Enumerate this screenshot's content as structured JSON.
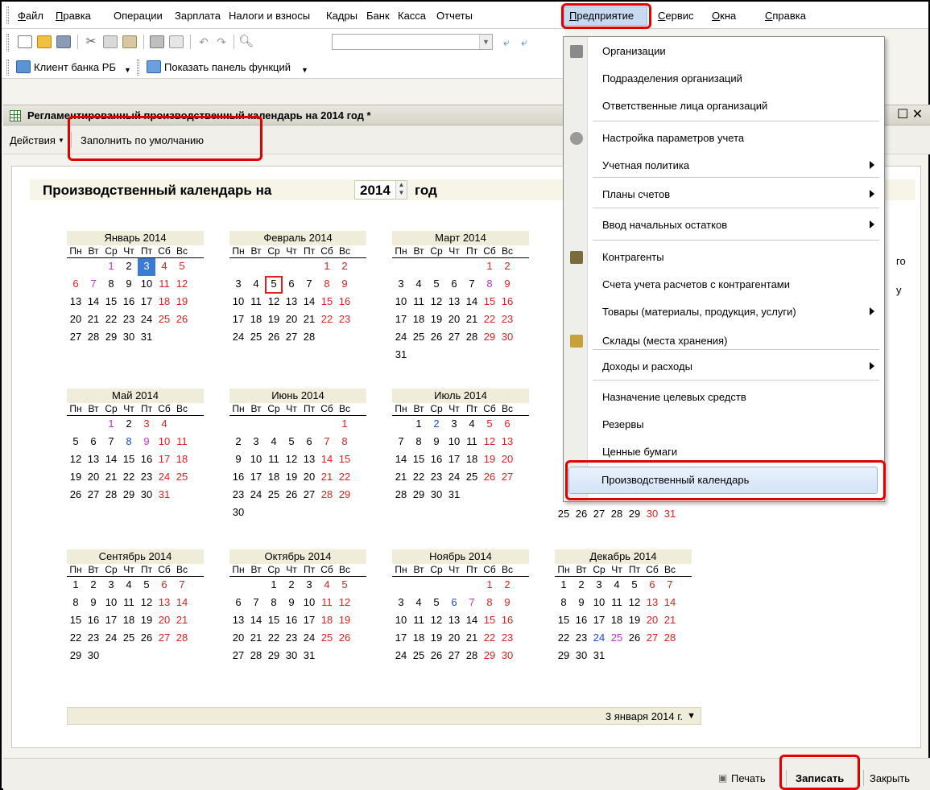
{
  "menubar": {
    "items": [
      "Файл",
      "Правка",
      "Операции",
      "Зарплата",
      "Налоги и взносы",
      "Кадры",
      "Банк",
      "Касса",
      "Отчеты",
      "Предприятие",
      "Сервис",
      "Окна",
      "Справка"
    ]
  },
  "toolbar2": {
    "bank_client": "Клиент банка РБ",
    "show_panel": "Показать панель функций"
  },
  "document": {
    "title": "Регламентированный производственный календарь на 2014 год *",
    "actions_label": "Действия",
    "fill_default": "Заполнить по умолчанию",
    "calendar_label": "Производственный календарь на",
    "year": "2014",
    "year_suffix": "год",
    "selected_date": "3 января 2014 г.",
    "partial_text": [
      "го",
      "у"
    ]
  },
  "weekday_headers": [
    "Пн",
    "Вт",
    "Ср",
    "Чт",
    "Пт",
    "Сб",
    "Вс"
  ],
  "months": [
    {
      "name": "Январь 2014",
      "weeks": [
        [
          null,
          null,
          "1",
          "2",
          "3",
          "4",
          "5"
        ],
        [
          "6",
          "7",
          "8",
          "9",
          "10",
          "11",
          "12"
        ],
        [
          "13",
          "14",
          "15",
          "16",
          "17",
          "18",
          "19"
        ],
        [
          "20",
          "21",
          "22",
          "23",
          "24",
          "25",
          "26"
        ],
        [
          "27",
          "28",
          "29",
          "30",
          "31",
          null,
          null
        ]
      ]
    },
    {
      "name": "Февраль 2014",
      "weeks": [
        [
          null,
          null,
          null,
          null,
          null,
          "1",
          "2"
        ],
        [
          "3",
          "4",
          "5",
          "6",
          "7",
          "8",
          "9"
        ],
        [
          "10",
          "11",
          "12",
          "13",
          "14",
          "15",
          "16"
        ],
        [
          "17",
          "18",
          "19",
          "20",
          "21",
          "22",
          "23"
        ],
        [
          "24",
          "25",
          "26",
          "27",
          "28",
          null,
          null
        ]
      ]
    },
    {
      "name": "Март 2014",
      "weeks": [
        [
          null,
          null,
          null,
          null,
          null,
          "1",
          "2"
        ],
        [
          "3",
          "4",
          "5",
          "6",
          "7",
          "8",
          "9"
        ],
        [
          "10",
          "11",
          "12",
          "13",
          "14",
          "15",
          "16"
        ],
        [
          "17",
          "18",
          "19",
          "20",
          "21",
          "22",
          "23"
        ],
        [
          "24",
          "25",
          "26",
          "27",
          "28",
          "29",
          "30"
        ],
        [
          "31",
          null,
          null,
          null,
          null,
          null,
          null
        ]
      ]
    },
    {
      "name": "Май 2014",
      "weeks": [
        [
          null,
          null,
          "1",
          "2",
          "3",
          "4",
          null
        ],
        [
          "5",
          "6",
          "7",
          "8",
          "9",
          "10",
          "11"
        ],
        [
          "12",
          "13",
          "14",
          "15",
          "16",
          "17",
          "18"
        ],
        [
          "19",
          "20",
          "21",
          "22",
          "23",
          "24",
          "25"
        ],
        [
          "26",
          "27",
          "28",
          "29",
          "30",
          "31",
          null
        ]
      ]
    },
    {
      "name": "Июнь 2014",
      "weeks": [
        [
          null,
          null,
          null,
          null,
          null,
          null,
          "1"
        ],
        [
          "2",
          "3",
          "4",
          "5",
          "6",
          "7",
          "8"
        ],
        [
          "9",
          "10",
          "11",
          "12",
          "13",
          "14",
          "15"
        ],
        [
          "16",
          "17",
          "18",
          "19",
          "20",
          "21",
          "22"
        ],
        [
          "23",
          "24",
          "25",
          "26",
          "27",
          "28",
          "29"
        ],
        [
          "30",
          null,
          null,
          null,
          null,
          null,
          null
        ]
      ]
    },
    {
      "name": "Июль 2014",
      "weeks": [
        [
          null,
          "1",
          "2",
          "3",
          "4",
          "5",
          "6"
        ],
        [
          "7",
          "8",
          "9",
          "10",
          "11",
          "12",
          "13"
        ],
        [
          "14",
          "15",
          "16",
          "17",
          "18",
          "19",
          "20"
        ],
        [
          "21",
          "22",
          "23",
          "24",
          "25",
          "26",
          "27"
        ],
        [
          "28",
          "29",
          "30",
          "31",
          null,
          null,
          null
        ]
      ]
    },
    {
      "name": "Сентябрь 2014",
      "weeks": [
        [
          "1",
          "2",
          "3",
          "4",
          "5",
          "6",
          "7"
        ],
        [
          "8",
          "9",
          "10",
          "11",
          "12",
          "13",
          "14"
        ],
        [
          "15",
          "16",
          "17",
          "18",
          "19",
          "20",
          "21"
        ],
        [
          "22",
          "23",
          "24",
          "25",
          "26",
          "27",
          "28"
        ],
        [
          "29",
          "30",
          null,
          null,
          null,
          null,
          null
        ]
      ]
    },
    {
      "name": "Октябрь 2014",
      "weeks": [
        [
          null,
          null,
          "1",
          "2",
          "3",
          "4",
          "5"
        ],
        [
          "6",
          "7",
          "8",
          "9",
          "10",
          "11",
          "12"
        ],
        [
          "13",
          "14",
          "15",
          "16",
          "17",
          "18",
          "19"
        ],
        [
          "20",
          "21",
          "22",
          "23",
          "24",
          "25",
          "26"
        ],
        [
          "27",
          "28",
          "29",
          "30",
          "31",
          null,
          null
        ]
      ]
    },
    {
      "name": "Ноябрь 2014",
      "weeks": [
        [
          null,
          null,
          null,
          null,
          null,
          "1",
          "2"
        ],
        [
          "3",
          "4",
          "5",
          "6",
          "7",
          "8",
          "9"
        ],
        [
          "10",
          "11",
          "12",
          "13",
          "14",
          "15",
          "16"
        ],
        [
          "17",
          "18",
          "19",
          "20",
          "21",
          "22",
          "23"
        ],
        [
          "24",
          "25",
          "26",
          "27",
          "28",
          "29",
          "30"
        ]
      ]
    },
    {
      "name": "Декабрь 2014",
      "weeks": [
        [
          "1",
          "2",
          "3",
          "4",
          "5",
          "6",
          "7"
        ],
        [
          "8",
          "9",
          "10",
          "11",
          "12",
          "13",
          "14"
        ],
        [
          "15",
          "16",
          "17",
          "18",
          "19",
          "20",
          "21"
        ],
        [
          "22",
          "23",
          "24",
          "25",
          "26",
          "27",
          "28"
        ],
        [
          "29",
          "30",
          "31",
          null,
          null,
          null,
          null
        ]
      ]
    },
    {
      "name": "",
      "weeks": [
        [
          "25",
          "26",
          "27",
          "28",
          "29",
          "30",
          "31"
        ]
      ]
    }
  ],
  "dropdown": {
    "items": [
      {
        "label": "Организации",
        "icon": "document-icon"
      },
      {
        "label": "Подразделения организаций"
      },
      {
        "label": "Ответственные лица организаций"
      },
      {
        "label": "Настройка параметров учета",
        "icon": "gear-icon"
      },
      {
        "label": "Учетная политика",
        "submenu": true
      },
      {
        "label": "Планы счетов",
        "submenu": true
      },
      {
        "label": "Ввод начальных остатков",
        "submenu": true
      },
      {
        "label": "Контрагенты",
        "icon": "contractors-icon"
      },
      {
        "label": "Счета учета расчетов с контрагентами"
      },
      {
        "label": "Товары (материалы, продукция, услуги)",
        "submenu": true
      },
      {
        "label": "Склады (места хранения)",
        "icon": "warehouse-icon"
      },
      {
        "label": "Доходы и расходы",
        "submenu": true
      },
      {
        "label": "Назначение целевых средств"
      },
      {
        "label": "Резервы"
      },
      {
        "label": "Ценные бумаги"
      },
      {
        "label": "Производственный календарь",
        "highlighted": true
      }
    ]
  },
  "statusbar": {
    "print": "Печать",
    "save": "Записать",
    "close": "Закрыть"
  },
  "colors": {
    "weekend": "#e21f1f",
    "preholiday": "#c32fd6",
    "transferred": "#1b49d6",
    "selected": "#3b7bd8",
    "highlight_box": "#e00000"
  }
}
